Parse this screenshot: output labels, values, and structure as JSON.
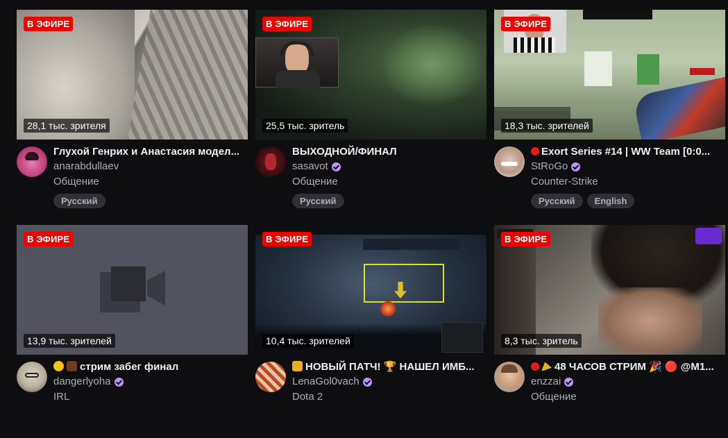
{
  "live_label": "В ЭФИРЕ",
  "streams": [
    {
      "viewers": "28,1 тыс. зрителя",
      "title": "Глухой Генрих и Анастасия модел...",
      "channel": "anarabdullaev",
      "verified": false,
      "category": "Общение",
      "tags": [
        "Русский"
      ]
    },
    {
      "viewers": "25,5 тыс. зритель",
      "title": "ВЫХОДНОЙ/ФИНАЛ",
      "channel": "sasavot",
      "verified": true,
      "category": "Общение",
      "tags": [
        "Русский"
      ]
    },
    {
      "viewers": "18,3 тыс. зрителей",
      "title": "Exort Series #14 | WW Team [0:0...",
      "channel": "StRoGo",
      "verified": true,
      "category": "Counter-Strike",
      "tags": [
        "Русский",
        "English"
      ]
    },
    {
      "viewers": "13,9 тыс. зрителей",
      "title": "стрим забег финал",
      "channel": "dangerlyoha",
      "verified": true,
      "category": "IRL",
      "tags": []
    },
    {
      "viewers": "10,4 тыс. зрителей",
      "title": "НОВЫЙ ПАТЧ! 🏆 НАШЕЛ ИМБ...",
      "channel": "LenaGol0vach",
      "verified": true,
      "category": "Dota 2",
      "tags": []
    },
    {
      "viewers": "8,3 тыс. зритель",
      "title": "48 ЧАСОВ СТРИМ 🎉 🔴 @M1...",
      "channel": "enzzai",
      "verified": true,
      "category": "Общение",
      "tags": []
    }
  ],
  "colors": {
    "live_badge": "#eb0400",
    "verified": "#bf94ff",
    "background": "#0e0e10"
  }
}
